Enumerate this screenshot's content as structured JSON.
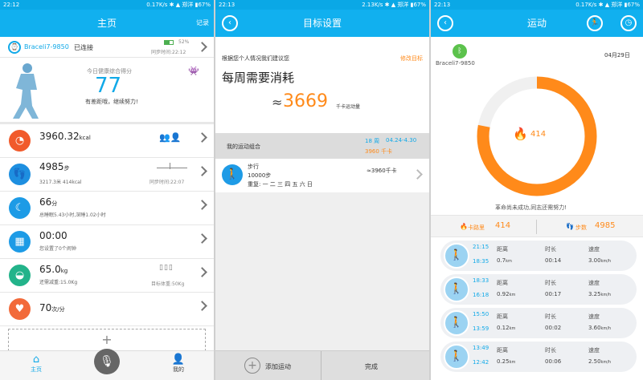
{
  "p1": {
    "status": {
      "time": "22:12",
      "speed": "0.17K/s",
      "carrier": "郑洋",
      "battery": "67%"
    },
    "title": "主页",
    "record": "记录",
    "device": {
      "name": "Braceli7-9850",
      "state": "已连接",
      "battery": "52%",
      "sync": "同步时间:22:12"
    },
    "score": {
      "label": "今日健康综合得分",
      "value": "77",
      "sub": "有差距哦，继续努力!"
    },
    "rows": [
      {
        "value": "3960.32",
        "unit": "kcal"
      },
      {
        "value": "4985",
        "unit": "步",
        "sub": "3217.3米  414kcal",
        "side": "同步时间:22:07"
      },
      {
        "value": "66",
        "unit": "分",
        "sub": "总睡眠5.43小时,深睡1.02小时"
      },
      {
        "value": "00:00",
        "sub": "您设置了0个闹钟"
      },
      {
        "value": "65.0",
        "unit": "kg",
        "sub": "还需减重:15.0Kg",
        "side": "目标体重:50Kg"
      },
      {
        "value": "70",
        "unit": "次/分"
      }
    ],
    "nav": {
      "home": "主页",
      "me": "我的"
    },
    "icons": {
      "home": "home-icon",
      "mic": "microphone-icon",
      "me": "user-icon"
    }
  },
  "p2": {
    "status": {
      "time": "22:13",
      "speed": "2.13K/s",
      "carrier": "郑洋",
      "battery": "67%"
    },
    "title": "目标设置",
    "suggest": "根据您个人情况我们建议您",
    "edit": "修改目标",
    "headline": "每周需要消耗",
    "approx": "≈",
    "kcal": "3669",
    "kcal_unit": "千卡运动量",
    "combo": {
      "label": "我的运动组合",
      "week": "18 周",
      "range": "04.24-4.30",
      "total": "3960 千卡"
    },
    "exercise": {
      "name": "步行",
      "steps": "10000步",
      "repeat": "重复: 一 二 三 四 五 六 日",
      "kcal": "≈3960千卡"
    },
    "buttons": {
      "add": "添加运动",
      "done": "完成"
    }
  },
  "p3": {
    "status": {
      "time": "22:13",
      "speed": "0.17K/s",
      "carrier": "郑洋",
      "battery": "67%"
    },
    "title": "运动",
    "device": "Braceli7-9850",
    "date": "04月29日",
    "ring": {
      "value": "414",
      "progress": 0.78
    },
    "msg": "革命尚未成功,同志还需努力!",
    "stats": {
      "cal_label": "卡路里",
      "cal": "414",
      "steps_label": "步数",
      "steps": "4985"
    },
    "labels": {
      "dist": "距离",
      "dur": "时长",
      "speed": "速度"
    },
    "acts": [
      {
        "end": "21:15",
        "start": "18:35",
        "dist": "0.7",
        "dist_u": "km",
        "dur": "00:14",
        "speed": "3.00",
        "speed_u": "km/h"
      },
      {
        "end": "18:33",
        "start": "16:18",
        "dist": "0.92",
        "dist_u": "km",
        "dur": "00:17",
        "speed": "3.25",
        "speed_u": "km/h"
      },
      {
        "end": "15:50",
        "start": "13:59",
        "dist": "0.12",
        "dist_u": "km",
        "dur": "00:02",
        "speed": "3.60",
        "speed_u": "km/h"
      },
      {
        "end": "13:49",
        "start": "12:42",
        "dist": "0.25",
        "dist_u": "km",
        "dur": "00:06",
        "speed": "2.50",
        "speed_u": "km/h"
      }
    ]
  },
  "colors": {
    "blue": "#11b0ef",
    "orange": "#ff8a1a"
  }
}
